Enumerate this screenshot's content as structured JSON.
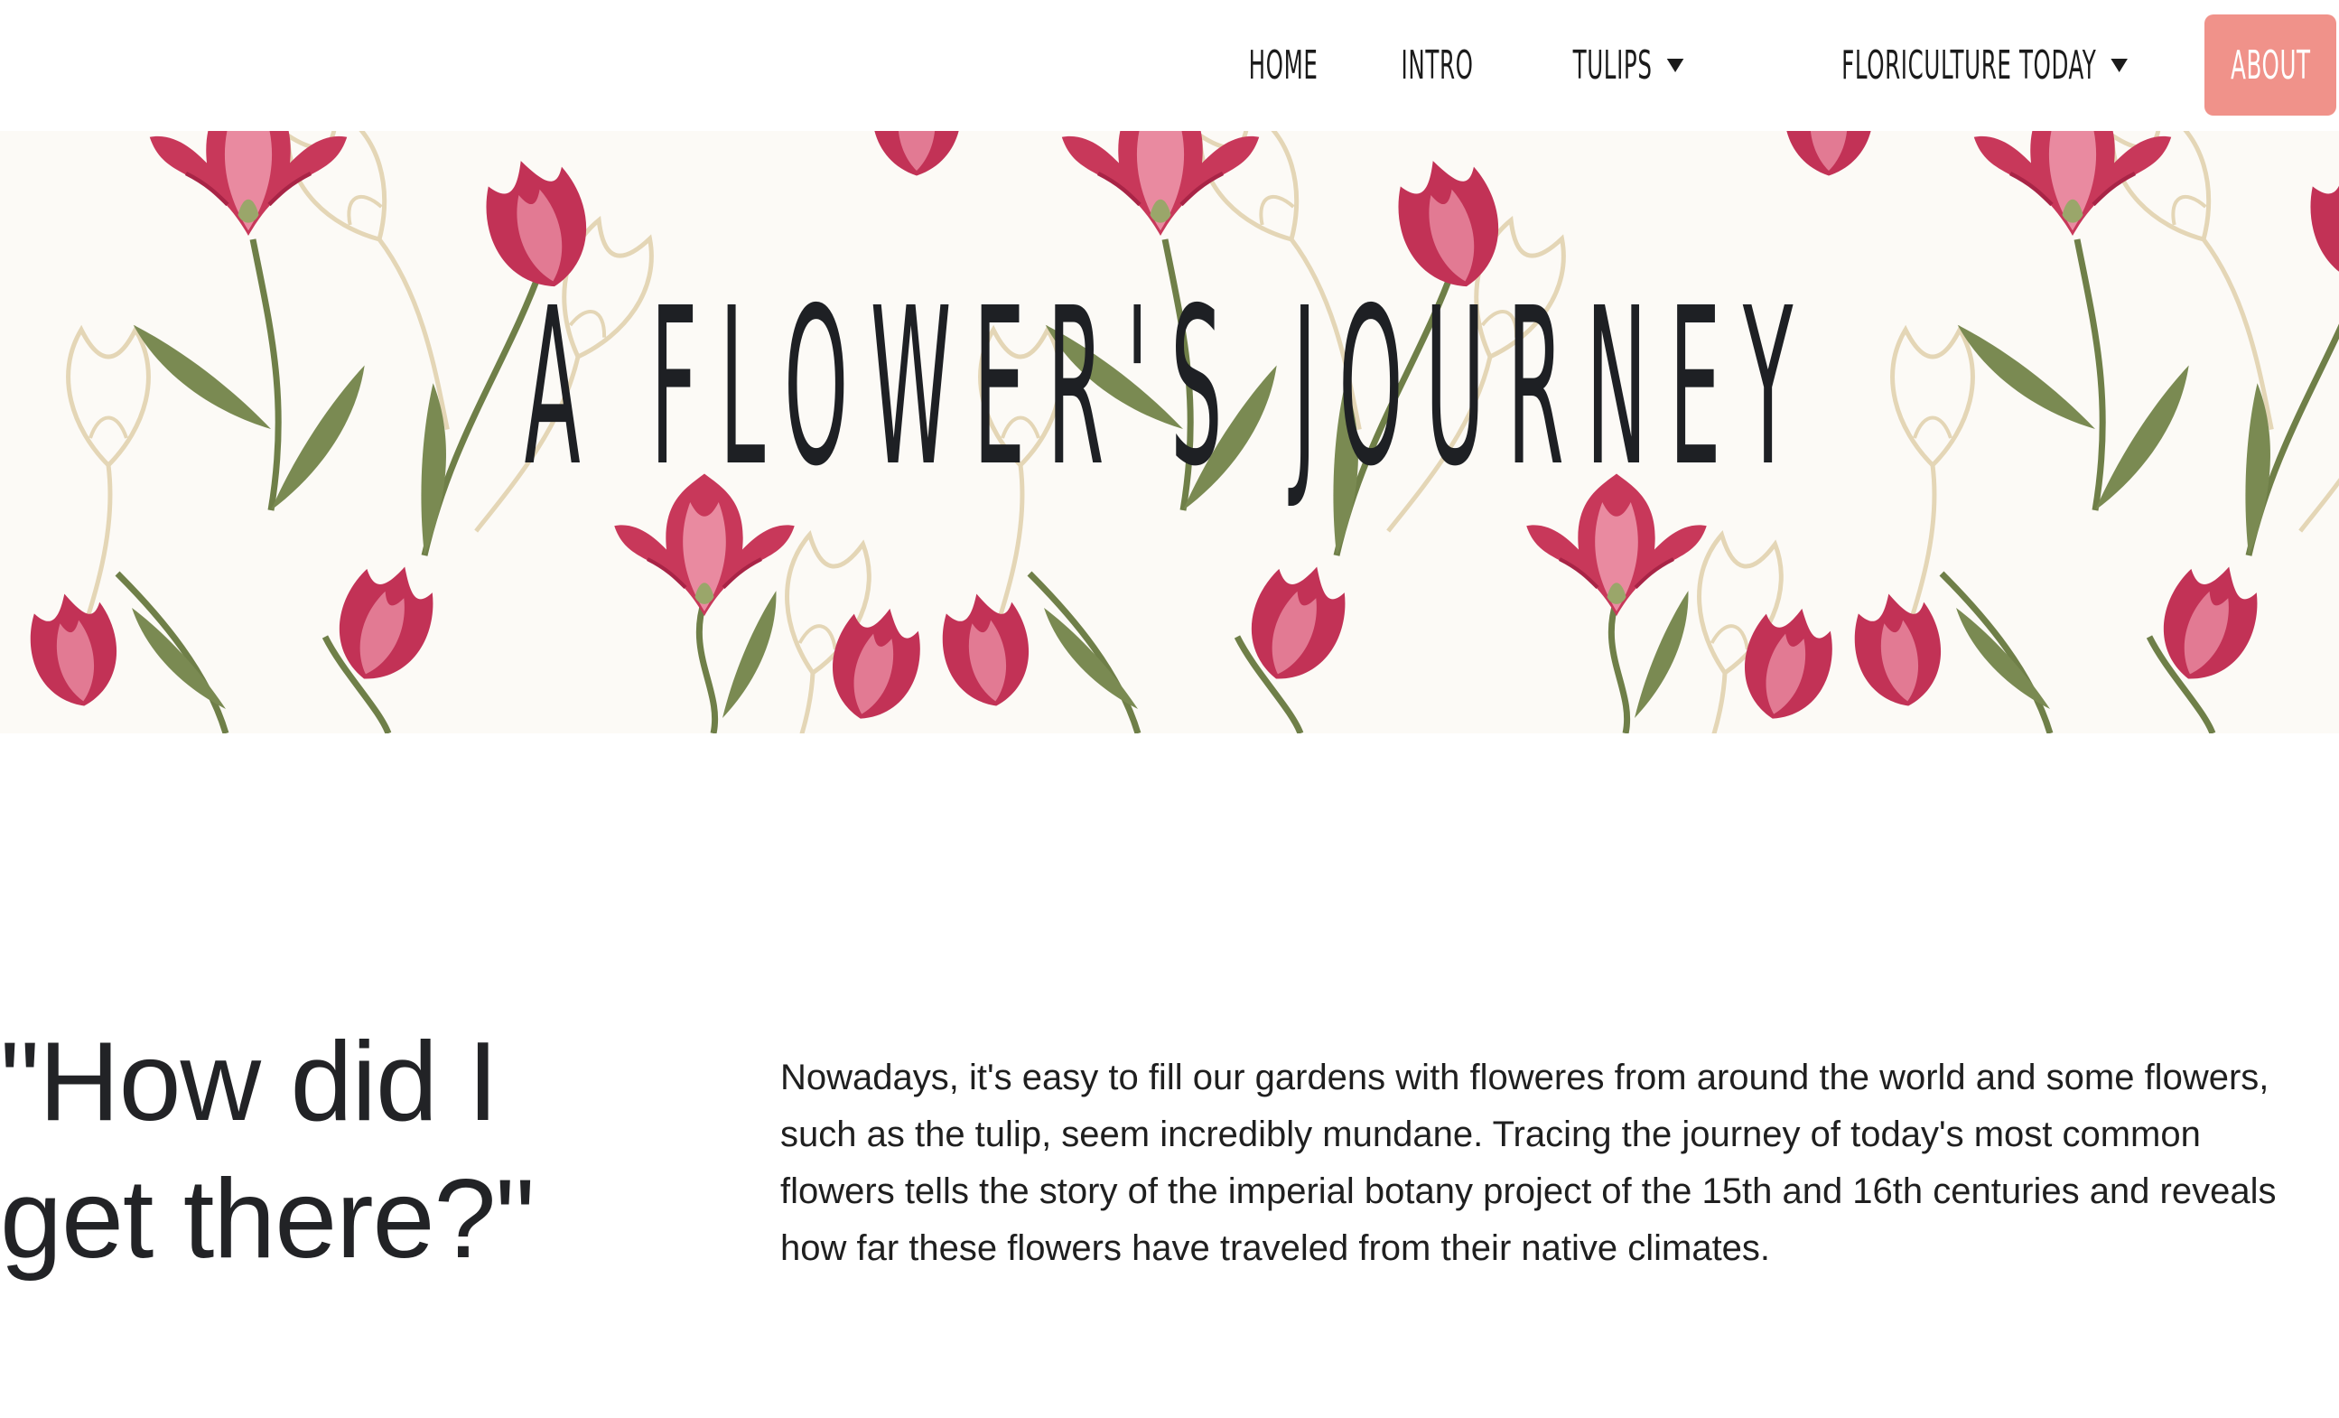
{
  "nav": {
    "items": [
      {
        "label": "Home",
        "dropdown": false
      },
      {
        "label": "Intro",
        "dropdown": false
      },
      {
        "label": "Tulips",
        "dropdown": true
      },
      {
        "label": "Floriculture Today",
        "dropdown": true
      }
    ],
    "about_label": "About",
    "about_color": "#f0928a"
  },
  "hero": {
    "title": "A Flower's Journey",
    "background_motif": "tulip-pattern",
    "colors": {
      "petal": "#c8385a",
      "petal_light": "#e98aa0",
      "leaf": "#7a8a52",
      "sketch": "#e4d6b6"
    }
  },
  "main": {
    "quote": "\"How did I get there?\"",
    "intro": "Nowadays, it's easy to fill our gardens with floweres from around the world and some flowers, such as the tulip, seem incredibly mundane. Tracing the journey of today's most common flowers tells the story of the imperial botany project of the 15th and 16th centuries and reveals how far these flowers have traveled from their native climates."
  }
}
